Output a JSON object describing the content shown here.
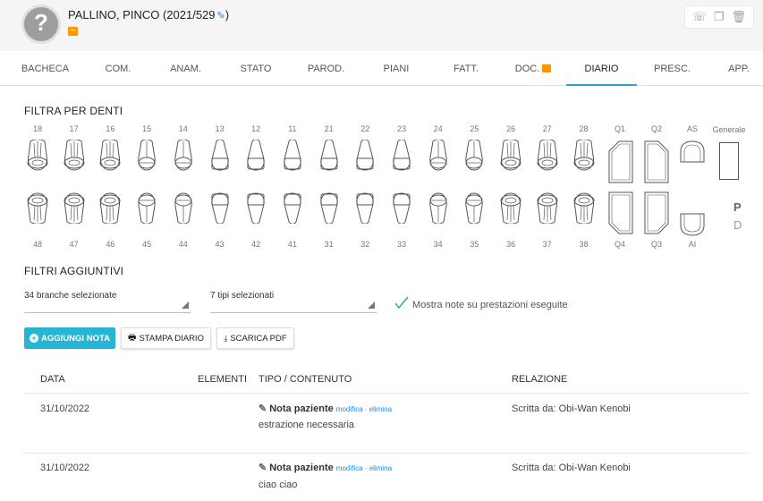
{
  "patient": {
    "name": "PALLINO, PINCO (2021/529",
    "close": ")",
    "avatar_glyph": "?"
  },
  "header_actions": [
    {
      "name": "whatsapp-icon",
      "glyph": "☏"
    },
    {
      "name": "copy-icon",
      "glyph": "❐"
    },
    {
      "name": "trash-icon",
      "glyph": "🗑"
    }
  ],
  "tabs": [
    "BACHECA",
    "COM.",
    "ANAM.",
    "STATO",
    "PAROD.",
    "PIANI",
    "FATT.",
    "DOC.",
    "DIARIO",
    "PRESC.",
    "APP."
  ],
  "active_tab": "DIARIO",
  "filter": {
    "title": "FILTRA PER DENTI",
    "upper": [
      "18",
      "17",
      "16",
      "15",
      "14",
      "13",
      "12",
      "11",
      "21",
      "22",
      "23",
      "24",
      "25",
      "26",
      "27",
      "28"
    ],
    "lower": [
      "48",
      "47",
      "46",
      "45",
      "44",
      "43",
      "42",
      "41",
      "31",
      "32",
      "33",
      "34",
      "35",
      "36",
      "37",
      "38"
    ],
    "quadrants_upper": [
      "Q1",
      "Q2"
    ],
    "quadrants_lower": [
      "Q4",
      "Q3"
    ],
    "arch_upper": "AS",
    "arch_lower": "AI",
    "general": "Generale",
    "p": "P",
    "d": "D"
  },
  "extra": {
    "title": "FILTRI AGGIUNTIVI",
    "branche": "34 branche selezionate",
    "tipi": "7 tipi selezionati",
    "check_label": "Mostra note su prestazioni eseguite",
    "check_color": "#26a69a"
  },
  "buttons": {
    "add": "AGGIUNGI NOTA",
    "print": "STAMPA DIARIO",
    "pdf": "SCARICA PDF"
  },
  "table": {
    "headers": [
      "DATA",
      "ELEMENTI",
      "TIPO / CONTENUTO",
      "RELAZIONE"
    ],
    "rows": [
      {
        "date": "31/10/2022",
        "type": "Nota paziente",
        "edit": "modifica",
        "sep": " - ",
        "delete": "elimina",
        "content": "estrazione necessaria",
        "relation": "Scritta da: Obi-Wan Kenobi"
      },
      {
        "date": "31/10/2022",
        "type": "Nota paziente",
        "edit": "modifica",
        "sep": " - ",
        "delete": "elimina",
        "content": "ciao ciao",
        "relation": "Scritta da: Obi-Wan Kenobi"
      }
    ]
  },
  "colors": {
    "accent": "#26b5d4",
    "tab_indicator": "#26a9c9",
    "link": "#1e88e5",
    "doc_icon": "#ff9800"
  }
}
